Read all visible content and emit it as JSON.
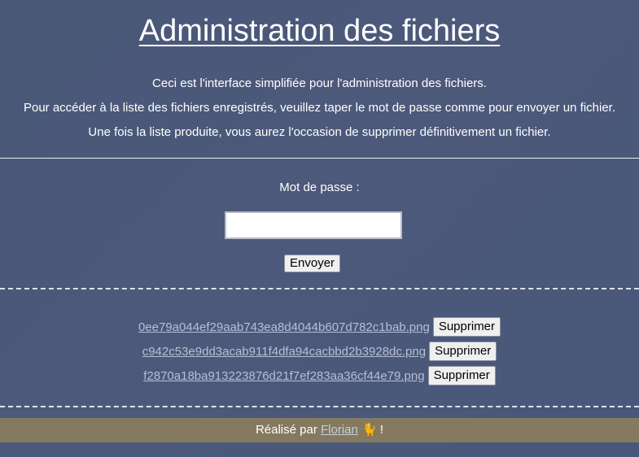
{
  "header": {
    "title": "Administration des fichiers"
  },
  "intro": {
    "line1": "Ceci est l'interface simplifiée pour l'administration des fichiers.",
    "line2": "Pour accéder à la liste des fichiers enregistrés, veuillez taper le mot de passe comme pour envoyer un fichier.",
    "line3": "Une fois la liste produite, vous aurez l'occasion de supprimer définitivement un fichier."
  },
  "form": {
    "password_label": "Mot de passe :",
    "password_value": "",
    "submit_label": "Envoyer"
  },
  "files": [
    {
      "name": "0ee79a044ef29aab743ea8d4044b607d782c1bab.png",
      "delete_label": "Supprimer"
    },
    {
      "name": "c942c53e9dd3acab911f4dfa94cacbbd2b3928dc.png",
      "delete_label": "Supprimer"
    },
    {
      "name": "f2870a18ba913223876d21f7ef283aa36cf44e79.png",
      "delete_label": "Supprimer"
    }
  ],
  "footer": {
    "prefix": "Réalisé par ",
    "author_link": "Florian",
    "cat_emoji": "🐈",
    "suffix": " !"
  },
  "colors": {
    "background": "#4a5878",
    "footer_bg": "#857a5f",
    "link": "#b7bfd4"
  },
  "icons": {
    "cat": "cat-emoji-icon"
  }
}
